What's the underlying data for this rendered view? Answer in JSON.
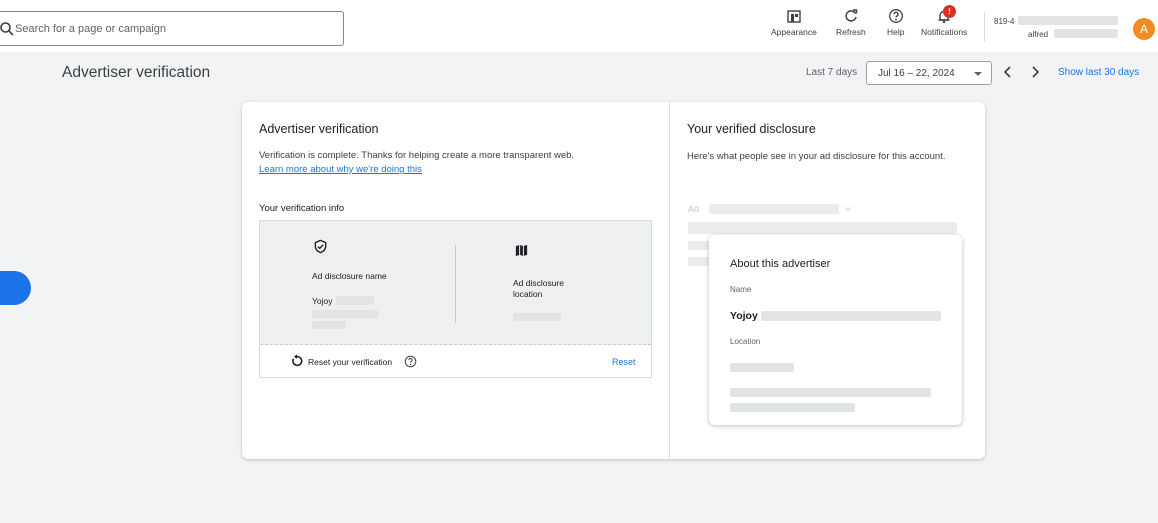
{
  "search": {
    "placeholder": "Search for a page or campaign"
  },
  "toolbar": {
    "appearance": "Appearance",
    "refresh": "Refresh",
    "help": "Help",
    "notifications": "Notifications",
    "notification_badge": "!"
  },
  "account": {
    "id": "819-4",
    "name": "alfred",
    "avatar_letter": "A",
    "avatar_color": "#f28b22"
  },
  "page": {
    "title": "Advertiser verification"
  },
  "date_range": {
    "label": "Last 7 days",
    "value": "Jul 16 – 22, 2024",
    "show_30": "Show last 30 days"
  },
  "left_panel": {
    "title": "Advertiser verification",
    "description": "Verification is complete. Thanks for helping create a more transparent web.",
    "learn_more": "Learn more about why we're doing this",
    "info_title": "Your verification info",
    "name_label": "Ad disclosure name",
    "name_value": "Yojoy",
    "location_label": "Ad disclosure location",
    "reset_text": "Reset your verification",
    "reset_button": "Reset"
  },
  "right_panel": {
    "title": "Your verified disclosure",
    "description": "Here's what people see in your ad disclosure for this account.",
    "ad_label": "Ad",
    "about_title": "About this advertiser",
    "name_label": "Name",
    "name_value": "Yojoy",
    "location_label": "Location"
  },
  "colors": {
    "accent": "#1a73e8",
    "badge": "#d93025"
  }
}
